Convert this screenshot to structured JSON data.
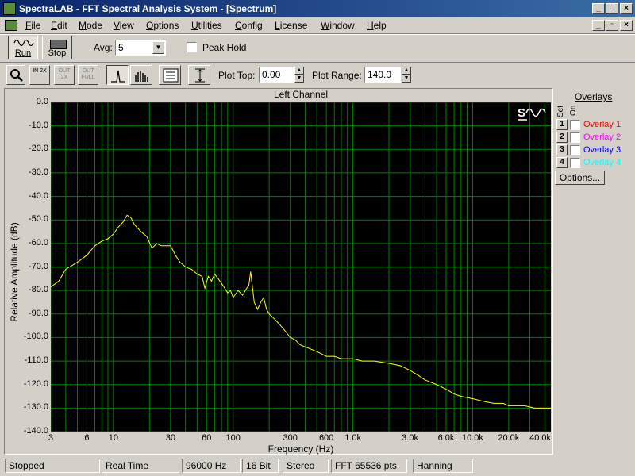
{
  "window": {
    "title": "SpectraLAB - FFT Spectral Analysis System - [Spectrum]"
  },
  "menu": [
    {
      "label": "File",
      "u": "F",
      "x": 32
    },
    {
      "label": "Edit",
      "u": "E",
      "x": 64
    },
    {
      "label": "Mode",
      "u": "M",
      "x": 99
    },
    {
      "label": "View",
      "u": "V",
      "x": 143
    },
    {
      "label": "Options",
      "u": "O",
      "x": 184
    },
    {
      "label": "Utilities",
      "u": "U",
      "x": 241
    },
    {
      "label": "Config",
      "u": "C",
      "x": 296
    },
    {
      "label": "License",
      "u": "L",
      "x": 346
    },
    {
      "label": "Window",
      "u": "W",
      "x": 404
    },
    {
      "label": "Help",
      "u": "H",
      "x": 462
    }
  ],
  "toolbar": {
    "run_label": "Run",
    "stop_label": "Stop",
    "avg_label": "Avg:",
    "avg_value": "5",
    "peak_hold_label": "Peak Hold",
    "peak_hold_checked": false,
    "plot_top_label": "Plot Top:",
    "plot_top_value": "0.00",
    "plot_range_label": "Plot Range:",
    "plot_range_value": "140.0",
    "zoom_in_2x": "IN 2X",
    "zoom_out_2x": "OUT 2X",
    "zoom_out_full": "OUT FULL"
  },
  "overlays": {
    "title": "Overlays",
    "col_set": "Set",
    "col_on": "On",
    "items": [
      {
        "num": "1",
        "label": "Overlay 1",
        "color": "#ff0000"
      },
      {
        "num": "2",
        "label": "Overlay 2",
        "color": "#ff00ff"
      },
      {
        "num": "3",
        "label": "Overlay 3",
        "color": "#0000ff"
      },
      {
        "num": "4",
        "label": "Overlay 4",
        "color": "#00ffff"
      }
    ],
    "options_label": "Options..."
  },
  "status": [
    "Stopped",
    "Real Time",
    "96000 Hz",
    "16 Bit",
    "Stereo",
    "FFT 65536 pts",
    "Hanning"
  ],
  "chart_data": {
    "type": "line",
    "title": "Left Channel",
    "xlabel": "Frequency (Hz)",
    "ylabel": "Relative Amplitude (dB)",
    "x_scale": "log",
    "xlim": [
      3,
      45000
    ],
    "ylim": [
      -140,
      0
    ],
    "y_ticks": [
      0,
      -10,
      -20,
      -30,
      -40,
      -50,
      -60,
      -70,
      -80,
      -90,
      -100,
      -110,
      -120,
      -130,
      -140
    ],
    "y_tick_labels": [
      "0.0",
      "-10.0",
      "-20.0",
      "-30.0",
      "-40.0",
      "-50.0",
      "-60.0",
      "-70.0",
      "-80.0",
      "-90.0",
      "-100.0",
      "-110.0",
      "-120.0",
      "-130.0",
      "-140.0"
    ],
    "x_ticks": [
      3,
      6,
      10,
      30,
      60,
      100,
      300,
      600,
      1000,
      3000,
      6000,
      10000,
      20000,
      40000
    ],
    "x_tick_labels": [
      "3",
      "6",
      "10",
      "30",
      "60",
      "100",
      "300",
      "600",
      "1.0k",
      "3.0k",
      "6.0k",
      "10.0k",
      "20.0k",
      "40.0k"
    ],
    "grid": true,
    "colors": {
      "background": "#000000",
      "grid": "#008000",
      "trace": "#ffff00"
    },
    "series": [
      {
        "x": [
          3,
          3.5,
          4,
          5,
          6,
          7,
          8,
          9,
          10,
          11,
          12,
          13,
          14,
          15,
          17,
          19,
          21,
          23,
          25,
          28,
          30,
          33,
          36,
          40,
          45,
          50,
          55,
          58,
          62,
          66,
          70,
          75,
          80,
          85,
          90,
          95,
          100,
          110,
          120,
          130,
          135,
          140,
          150,
          160,
          170,
          180,
          190,
          200,
          220,
          240,
          260,
          280,
          300,
          330,
          360,
          400,
          450,
          500,
          550,
          600,
          700,
          800,
          900,
          1000,
          1200,
          1500,
          2000,
          2500,
          3000,
          3500,
          4000,
          5000,
          6000,
          7000,
          8000,
          10000,
          12000,
          15000,
          18000,
          20000,
          24000,
          27000,
          30000,
          33000,
          36000,
          40000,
          45000
        ],
        "values": [
          -78.5,
          -76,
          -71,
          -68,
          -65,
          -61,
          -59,
          -58,
          -56,
          -53,
          -51,
          -48,
          -49,
          -52,
          -55,
          -57,
          -62,
          -60,
          -61,
          -61,
          -61,
          -65,
          -68,
          -70,
          -71,
          -73,
          -74,
          -79,
          -74,
          -76,
          -73,
          -75,
          -77,
          -79,
          -81,
          -80,
          -83,
          -80,
          -82,
          -79,
          -78,
          -72,
          -85,
          -88,
          -85,
          -83,
          -88,
          -90,
          -92,
          -94,
          -96,
          -98,
          -100,
          -101,
          -103,
          -104,
          -105,
          -106,
          -107,
          -108,
          -108,
          -109,
          -109,
          -109,
          -110,
          -110,
          -111,
          -112,
          -114,
          -116,
          -118,
          -120,
          -122,
          -124,
          -125,
          -126,
          -127,
          -128,
          -128,
          -129,
          -129,
          -129,
          -129.5,
          -130,
          -130,
          -130,
          -130
        ]
      }
    ]
  }
}
